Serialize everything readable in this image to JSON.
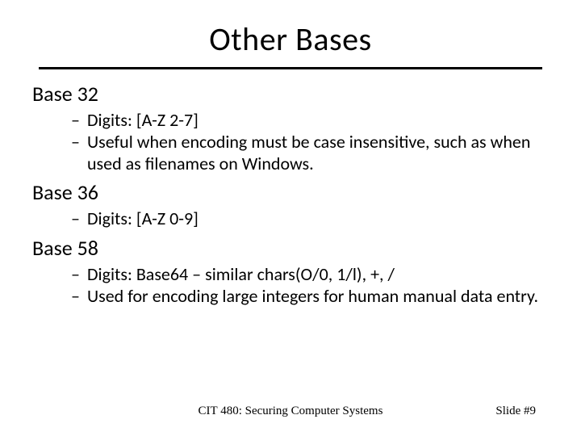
{
  "title": "Other Bases",
  "sections": [
    {
      "heading": "Base 32",
      "bullets": [
        "Digits: [A-Z 2-7]",
        "Useful when encoding must be case insensitive, such as when used as filenames on Windows."
      ]
    },
    {
      "heading": "Base 36",
      "bullets": [
        "Digits: [A-Z 0-9]"
      ]
    },
    {
      "heading": "Base 58",
      "bullets": [
        "Digits: Base64 – similar chars(O/0, 1/l), +, /",
        "Used for encoding large integers for human manual data entry."
      ]
    }
  ],
  "footer": {
    "center": "CIT 480: Securing Computer Systems",
    "right": "Slide #9"
  }
}
